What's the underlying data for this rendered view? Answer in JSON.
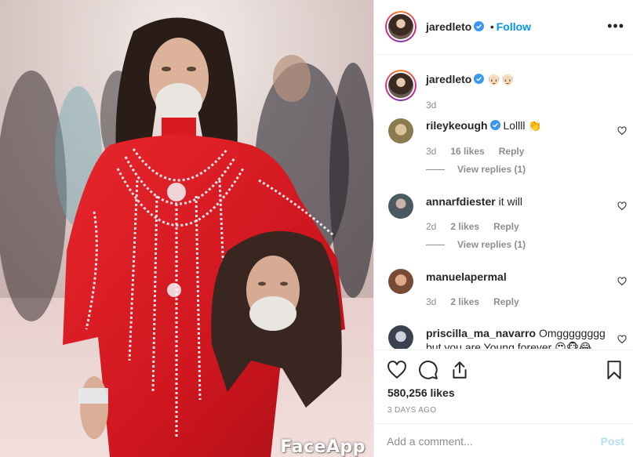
{
  "photo": {
    "watermark": "FaceApp"
  },
  "header": {
    "username": "jaredleto",
    "separator": "•",
    "follow_label": "Follow",
    "more_icon": "more-horizontal-icon"
  },
  "caption": {
    "username": "jaredleto",
    "text": "👴🏻👴🏻",
    "time": "3d"
  },
  "comments": [
    {
      "username": "rileykeough",
      "verified": true,
      "text": "Lollll 👏",
      "time": "3d",
      "likes": "16 likes",
      "reply_label": "Reply",
      "view_replies": "View replies (1)"
    },
    {
      "username": "annarfdiester",
      "verified": false,
      "text": "it will",
      "time": "2d",
      "likes": "2 likes",
      "reply_label": "Reply",
      "view_replies": "View replies (1)"
    },
    {
      "username": "manuelapermal",
      "verified": false,
      "text": "",
      "time": "3d",
      "likes": "2 likes",
      "reply_label": "Reply"
    },
    {
      "username": "priscilla_ma_navarro",
      "verified": false,
      "text": "Omgggggggg",
      "continuation": "but you are Young forever 😍🐵😂"
    }
  ],
  "actions": {
    "like_icon": "heart-icon",
    "comment_icon": "comment-icon",
    "share_icon": "share-icon",
    "save_icon": "bookmark-icon",
    "likes": "580,256 likes",
    "time": "3 DAYS AGO"
  },
  "add_comment": {
    "placeholder": "Add a comment...",
    "post_label": "Post"
  },
  "colors": {
    "accent": "#0095f6",
    "verified": "#3897f0",
    "muted": "#8e8e8e",
    "post_disabled": "#b2dffc",
    "dress_red": "#d81a22"
  }
}
